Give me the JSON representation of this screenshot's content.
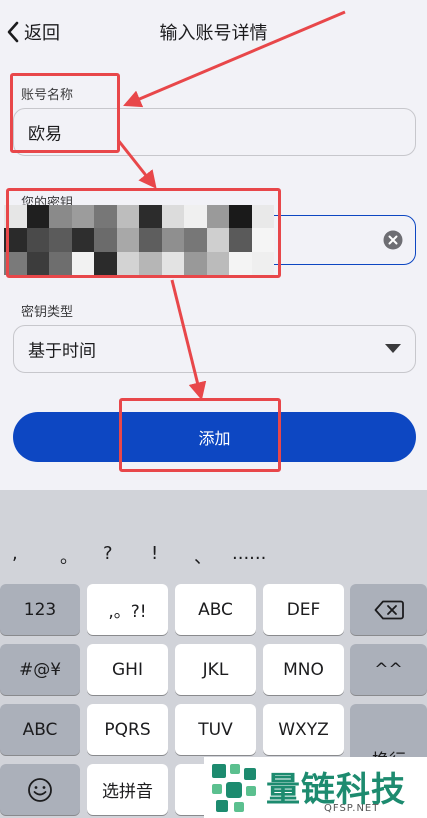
{
  "nav": {
    "back_label": "返回",
    "title": "输入账号详情"
  },
  "form": {
    "account_name_label": "账号名称",
    "account_name_value": "欧易",
    "secret_label": "您的密钥",
    "key_type_label": "密钥类型",
    "key_type_value": "基于时间"
  },
  "add_button": "添加",
  "candidates": [
    ",",
    "。",
    "?",
    "!",
    "、",
    "......"
  ],
  "keyboard": {
    "row1": [
      "123",
      ",。?!",
      "ABC",
      "DEF"
    ],
    "row2": [
      "#@¥",
      "GHI",
      "JKL",
      "MNO",
      "^^"
    ],
    "row3": [
      "ABC",
      "PQRS",
      "TUV",
      "WXYZ"
    ],
    "row4": [
      "选拼音"
    ],
    "partial_key": "换行"
  },
  "watermark": {
    "name": "量链科技",
    "site": "QFSP.NET"
  },
  "colors": {
    "primary": "#0d47c2",
    "annotation": "#e8474a"
  }
}
